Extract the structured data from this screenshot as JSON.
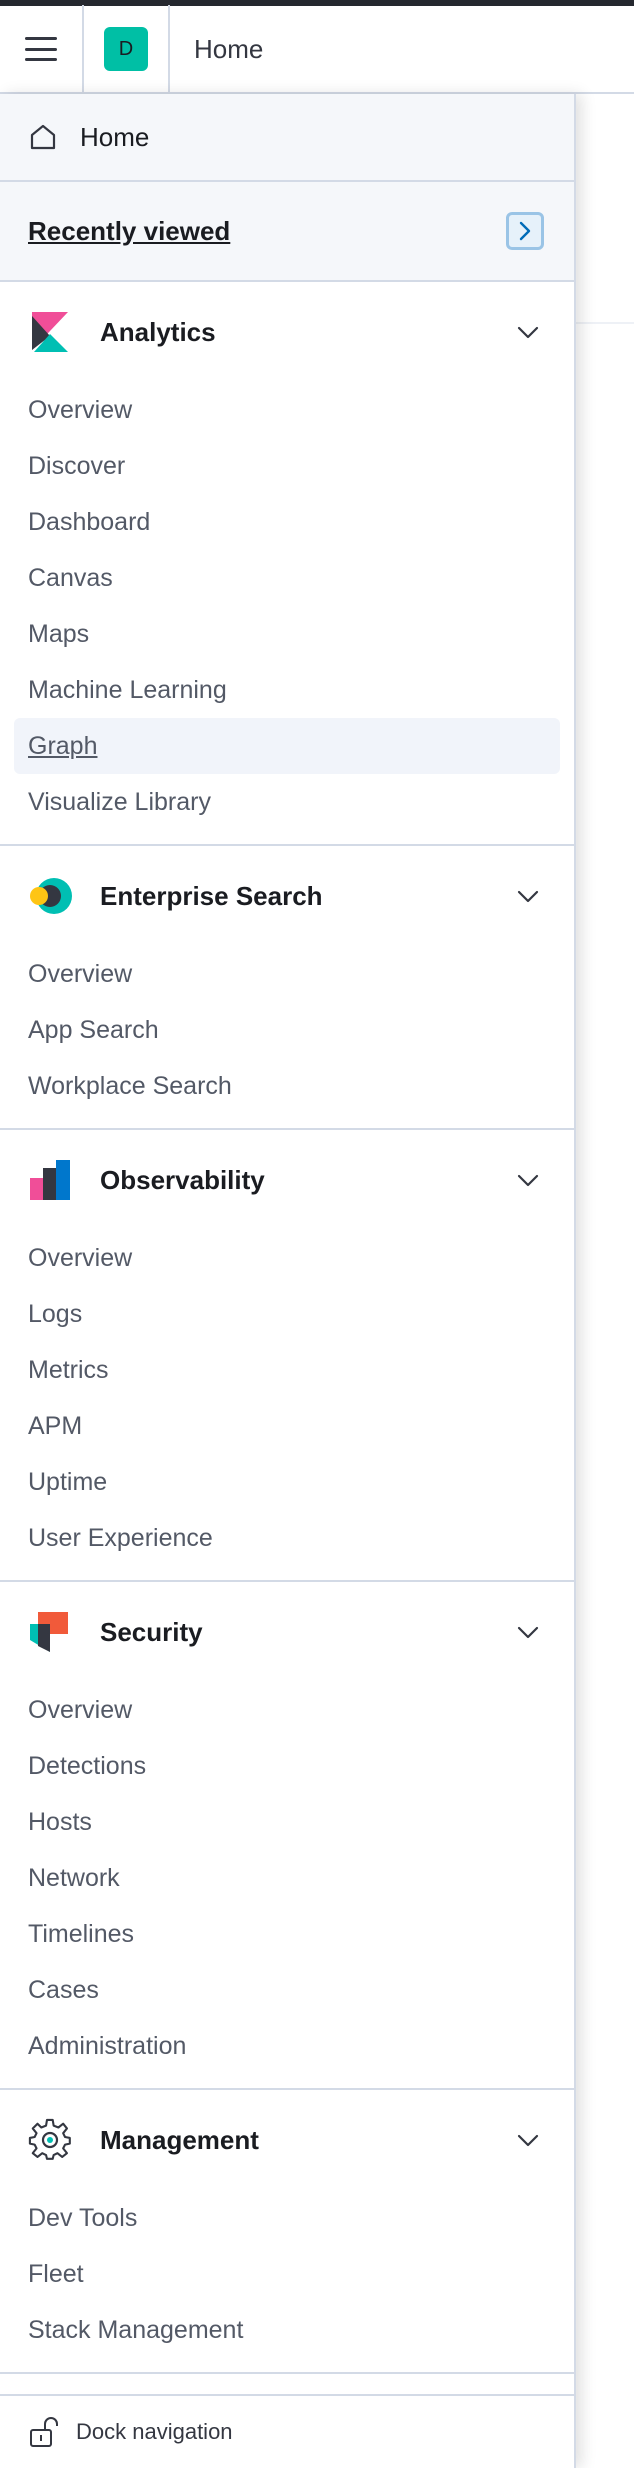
{
  "header": {
    "menu_icon": "hamburger-icon",
    "space_initial": "D",
    "breadcrumb": "Home"
  },
  "nav": {
    "home_label": "Home",
    "recently_viewed_label": "Recently viewed",
    "groups": [
      {
        "title": "Analytics",
        "logo_icon": "kibana-logo-icon",
        "items": [
          "Overview",
          "Discover",
          "Dashboard",
          "Canvas",
          "Maps",
          "Machine Learning",
          "Graph",
          "Visualize Library"
        ],
        "active_index": 6
      },
      {
        "title": "Enterprise Search",
        "logo_icon": "enterprise-search-logo-icon",
        "items": [
          "Overview",
          "App Search",
          "Workplace Search"
        ]
      },
      {
        "title": "Observability",
        "logo_icon": "observability-logo-icon",
        "items": [
          "Overview",
          "Logs",
          "Metrics",
          "APM",
          "Uptime",
          "User Experience"
        ]
      },
      {
        "title": "Security",
        "logo_icon": "security-logo-icon",
        "items": [
          "Overview",
          "Detections",
          "Hosts",
          "Network",
          "Timelines",
          "Cases",
          "Administration"
        ]
      },
      {
        "title": "Management",
        "logo_icon": "gear-icon",
        "items": [
          "Dev Tools",
          "Fleet",
          "Stack Management"
        ]
      }
    ],
    "dock_label": "Dock navigation"
  },
  "colors": {
    "accent_teal": "#00bfa5",
    "kibana_pink": "#f04e98",
    "security_orange": "#f15a3a",
    "observability_blue": "#0077cc",
    "link_blue": "#006bb8"
  }
}
